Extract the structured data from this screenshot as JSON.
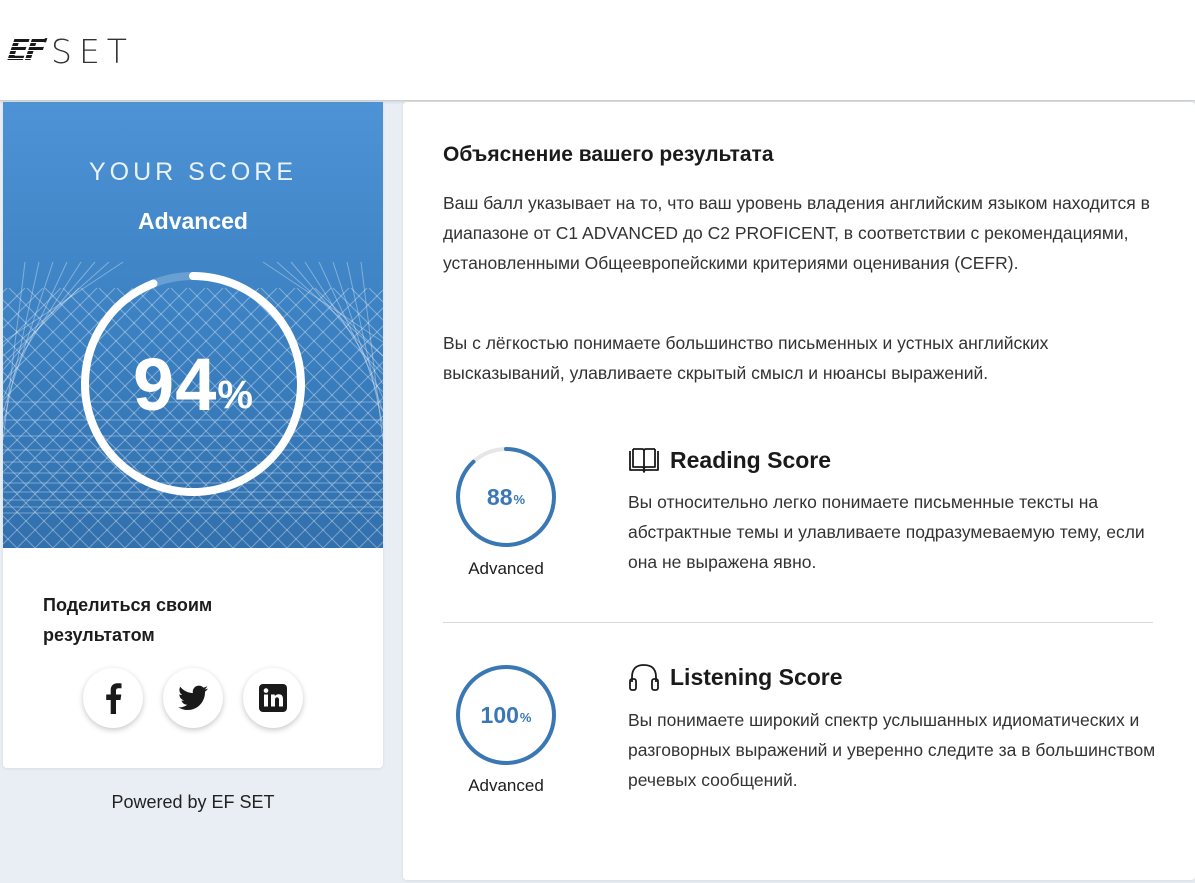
{
  "header": {
    "logo_ef": "EF",
    "logo_set": "SET"
  },
  "score_card": {
    "heading": "YOUR SCORE",
    "level": "Advanced",
    "score_value": "94",
    "score_symbol": "%",
    "score_fraction": 0.94
  },
  "share": {
    "title": "Поделиться своим результатом",
    "buttons": [
      {
        "name": "facebook",
        "icon": "facebook-icon"
      },
      {
        "name": "twitter",
        "icon": "twitter-icon"
      },
      {
        "name": "linkedin",
        "icon": "linkedin-icon"
      }
    ]
  },
  "powered_by": "Powered by EF SET",
  "explanation": {
    "title": "Объяснение вашего результата",
    "paragraph1": "Ваш балл указывает на то, что ваш уровень владения английским языком находится в диапазоне от C1 ADVANCED до C2 PROFICENT, в соответствии с рекомендациями, установленными Общеевропейскими критериями оценивания (CEFR).",
    "paragraph2": "Вы с лёгкостью понимаете большинство письменных и устных английских высказываний, улавливаете скрытый смысл и нюансы выражений."
  },
  "reading": {
    "icon": "book-icon",
    "title": "Reading Score",
    "score_value": "88",
    "score_symbol": "%",
    "score_fraction": 0.88,
    "level": "Advanced",
    "description": "Вы относительно легко понимаете письменные тексты на абстрактные темы и улавливаете подразумеваемую тему, если она не выражена явно."
  },
  "listening": {
    "icon": "headphones-icon",
    "title": "Listening Score",
    "score_value": "100",
    "score_symbol": "%",
    "score_fraction": 1.0,
    "level": "Advanced",
    "description": "Вы понимаете широкий спектр услышанных идиоматических и разговорных выражений и уверенно следите за в большинством речевых сообщений."
  },
  "colors": {
    "accent_blue": "#3a78b5",
    "panel_top": "#4d93d5",
    "panel_bottom": "#3270ad"
  }
}
